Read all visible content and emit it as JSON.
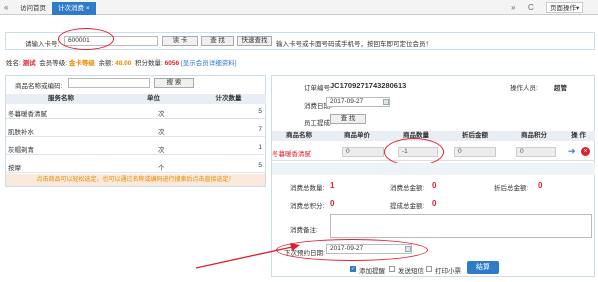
{
  "tabs": {
    "home": "访问首页",
    "active": "计次消费",
    "close": "×"
  },
  "toolbar": {
    "page_ops": "页面操作",
    "refresh": "C",
    "prev": "«",
    "next": "»",
    "dropdown": "▾"
  },
  "search": {
    "label": "请输入卡号:",
    "value": "600001",
    "read_btn": "读 卡",
    "query_btn": "查 找",
    "quick_btn": "快速查找",
    "hint": "输入卡号或卡面号码或手机号，按回车即可定位会员！"
  },
  "member": {
    "name_label": "姓名:",
    "name": "测试",
    "level_label": "会员等级:",
    "level": "金卡等级",
    "balance_label": "余额:",
    "balance": "48.00",
    "points_label": "积分数量:",
    "points": "6056",
    "detail_link": "[显示会员详细资料]"
  },
  "goods": {
    "filter_label": "商品名称或编码:",
    "filter_btn": "搜 索",
    "headers": [
      "服务名称",
      "单位",
      "计次数量"
    ],
    "rows": [
      {
        "name": "冬暮暖香清腻",
        "unit": "次",
        "qty": "5"
      },
      {
        "name": "肌肤补水",
        "unit": "次",
        "qty": "7"
      },
      {
        "name": "灰帽剃青",
        "unit": "次",
        "qty": "1"
      },
      {
        "name": "按摩",
        "unit": "个",
        "qty": "5"
      }
    ],
    "footer": "点击商品可以轻松选定，也可以通过名称或编码进行搜索后点击直接选定！"
  },
  "order": {
    "no_label": "订单编号:",
    "no": "JC1709271743280613",
    "operator_label": "操作人员:",
    "operator": "超管",
    "date_label": "消费日期:",
    "date": "2017-09-27",
    "staff_label": "员工提成:",
    "staff_btn": "查 找"
  },
  "items": {
    "headers": [
      "商品名称",
      "商品单价",
      "商品数量",
      "折后金额",
      "商品积分",
      "操 作"
    ],
    "row": {
      "name": "冬暮暖香清腻",
      "price": "0",
      "qty": "-1",
      "amount": "0",
      "points": "0"
    }
  },
  "summary": {
    "total_qty_label": "消费总数量:",
    "total_qty": "1",
    "total_amount_label": "消费总金额:",
    "total_amount": "0",
    "discount_label": "折后总金额:",
    "discount": "0",
    "total_points_label": "消费总积分:",
    "total_points": "0",
    "commission_label": "提成总金额:",
    "commission": "0",
    "note_label": "消费备注:",
    "next_date_label": "下次预约日期:",
    "next_date": "2017-09-27"
  },
  "footer": {
    "cb_reminder": "添加提醒",
    "cb_sms": "发送短信",
    "cb_print": "打印小票",
    "submit": "结算"
  }
}
